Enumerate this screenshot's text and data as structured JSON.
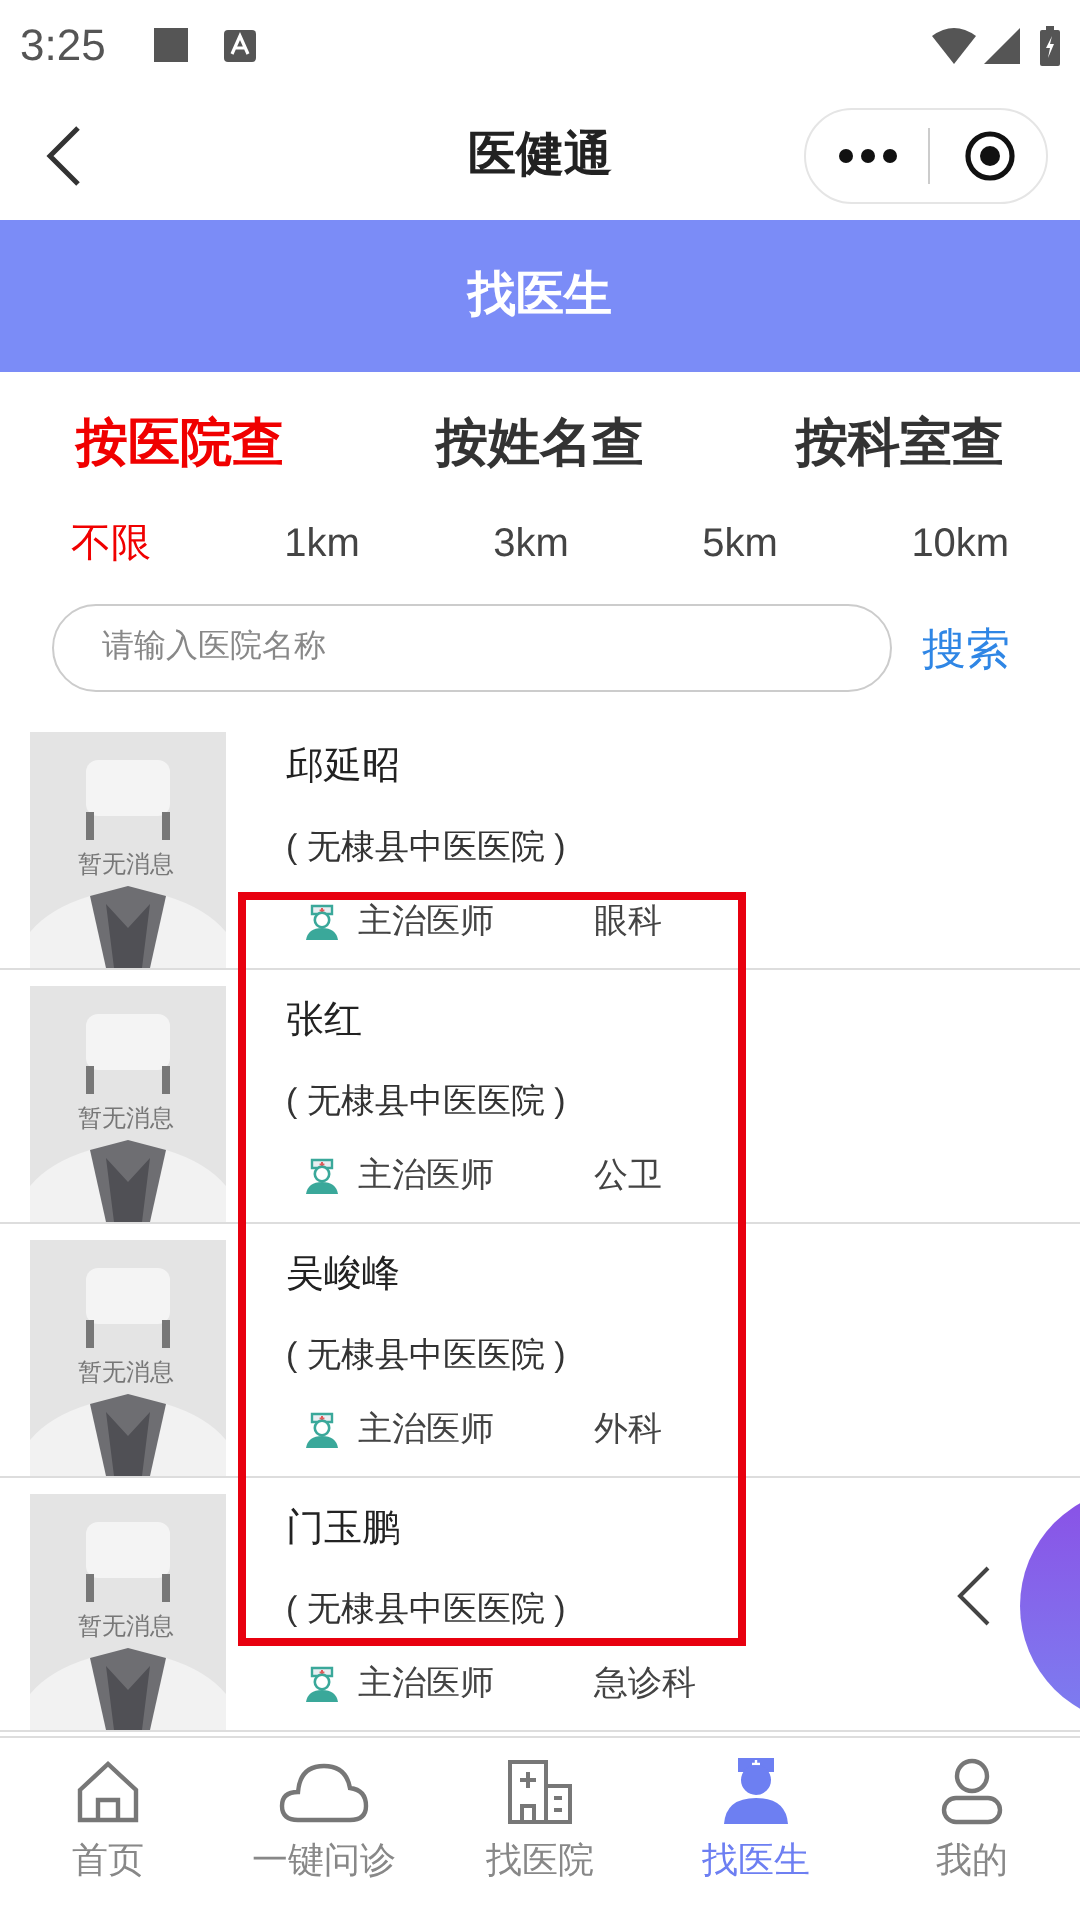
{
  "status_bar": {
    "time": "3:25"
  },
  "header": {
    "title": "医健通"
  },
  "banner": {
    "title": "找医生"
  },
  "search_tabs": [
    {
      "label": "按医院查",
      "selected": true
    },
    {
      "label": "按姓名查",
      "selected": false
    },
    {
      "label": "按科室查",
      "selected": false
    }
  ],
  "distance_filters": [
    {
      "label": "不限",
      "selected": true
    },
    {
      "label": "1km",
      "selected": false
    },
    {
      "label": "3km",
      "selected": false
    },
    {
      "label": "5km",
      "selected": false
    },
    {
      "label": "10km",
      "selected": false
    }
  ],
  "search": {
    "placeholder": "请输入医院名称",
    "button": "搜索"
  },
  "doctors": [
    {
      "name": "邱延昭",
      "hospital": "( 无棣县中医医院 )",
      "title": "主治医师",
      "department": "眼科",
      "avatar_caption": "暂无消息"
    },
    {
      "name": "张红",
      "hospital": "( 无棣县中医医院 )",
      "title": "主治医师",
      "department": "公卫",
      "avatar_caption": "暂无消息"
    },
    {
      "name": "吴峻峰",
      "hospital": "( 无棣县中医医院 )",
      "title": "主治医师",
      "department": "外科",
      "avatar_caption": "暂无消息"
    },
    {
      "name": "门玉鹏",
      "hospital": "( 无棣县中医医院 )",
      "title": "主治医师",
      "department": "急诊科",
      "avatar_caption": "暂无消息"
    }
  ],
  "bottom_nav": [
    {
      "label": "首页",
      "kind": "home",
      "selected": false
    },
    {
      "label": "一键问诊",
      "kind": "cloud",
      "selected": false
    },
    {
      "label": "找医院",
      "kind": "hospital",
      "selected": false
    },
    {
      "label": "找医生",
      "kind": "doctor",
      "selected": true
    },
    {
      "label": "我的",
      "kind": "user",
      "selected": false
    }
  ]
}
